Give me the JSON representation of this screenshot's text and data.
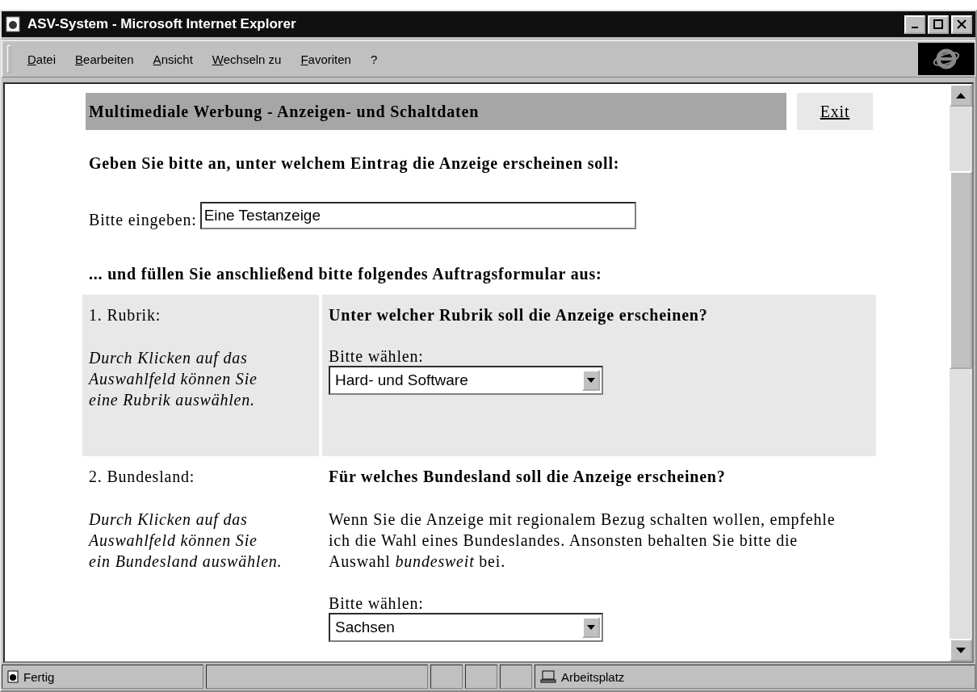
{
  "window": {
    "title": "ASV-System - Microsoft Internet Explorer"
  },
  "menu": [
    "Datei",
    "Bearbeiten",
    "Ansicht",
    "Wechseln zu",
    "Favoriten",
    "?"
  ],
  "header": {
    "title": "Multimediale Werbung - Anzeigen- und Schaltdaten",
    "exit": "Exit"
  },
  "prompt": "Geben Sie bitte an, unter welchem Eintrag die Anzeige erscheinen soll:",
  "entry": {
    "label": "Bitte eingeben:",
    "value": "Eine Testanzeige"
  },
  "form_intro": "... und füllen Sie anschließend bitte folgendes Auftragsformular aus:",
  "sections": [
    {
      "number_label": "1. Rubrik:",
      "hint": "Durch Klicken auf das Auswahlfeld können Sie eine Rubrik auswählen.",
      "question": "Unter welcher Rubrik soll die Anzeige erscheinen?",
      "select_label": "Bitte wählen:",
      "select_value": "Hard- und Software",
      "shaded": true
    },
    {
      "number_label": "2. Bundesland:",
      "hint": "Durch Klicken auf das Auswahlfeld können Sie ein Bundesland auswählen.",
      "question": "Für welches Bundesland soll die Anzeige erscheinen?",
      "description": "Wenn Sie die Anzeige mit regionalem Bezug schalten wollen, empfehle ich die Wahl eines Bundeslandes. Ansonsten behalten Sie bitte die Auswahl *bundesweit* bei.",
      "select_label": "Bitte wählen:",
      "select_value": "Sachsen",
      "shaded": false
    }
  ],
  "status_bar": {
    "text": "Fertig",
    "zone": "Arbeitsplatz"
  }
}
